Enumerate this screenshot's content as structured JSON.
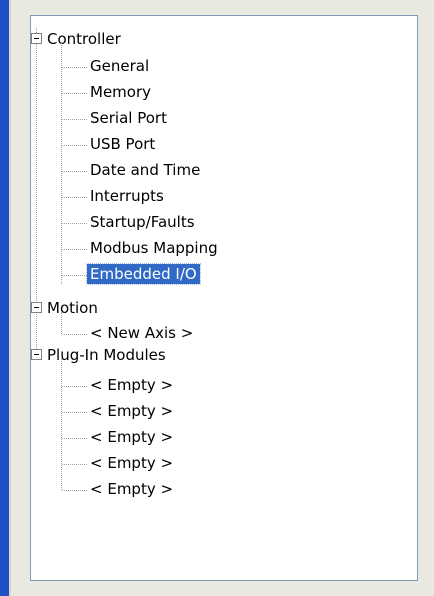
{
  "tree": {
    "controller": {
      "label": "Controller",
      "children": [
        "General",
        "Memory",
        "Serial Port",
        "USB Port",
        "Date and Time",
        "Interrupts",
        "Startup/Faults",
        "Modbus Mapping",
        "Embedded I/O"
      ],
      "selected_child": "Embedded I/O"
    },
    "motion": {
      "label": "Motion",
      "children": [
        "< New Axis >"
      ]
    },
    "plugin": {
      "label": "Plug-In Modules",
      "children": [
        "< Empty >",
        "< Empty >",
        "< Empty >",
        "< Empty >",
        "< Empty >"
      ]
    }
  },
  "colors": {
    "selection": "#316ac5",
    "accent_bar": "#1f4fc4",
    "panel_border": "#7f9db9"
  }
}
